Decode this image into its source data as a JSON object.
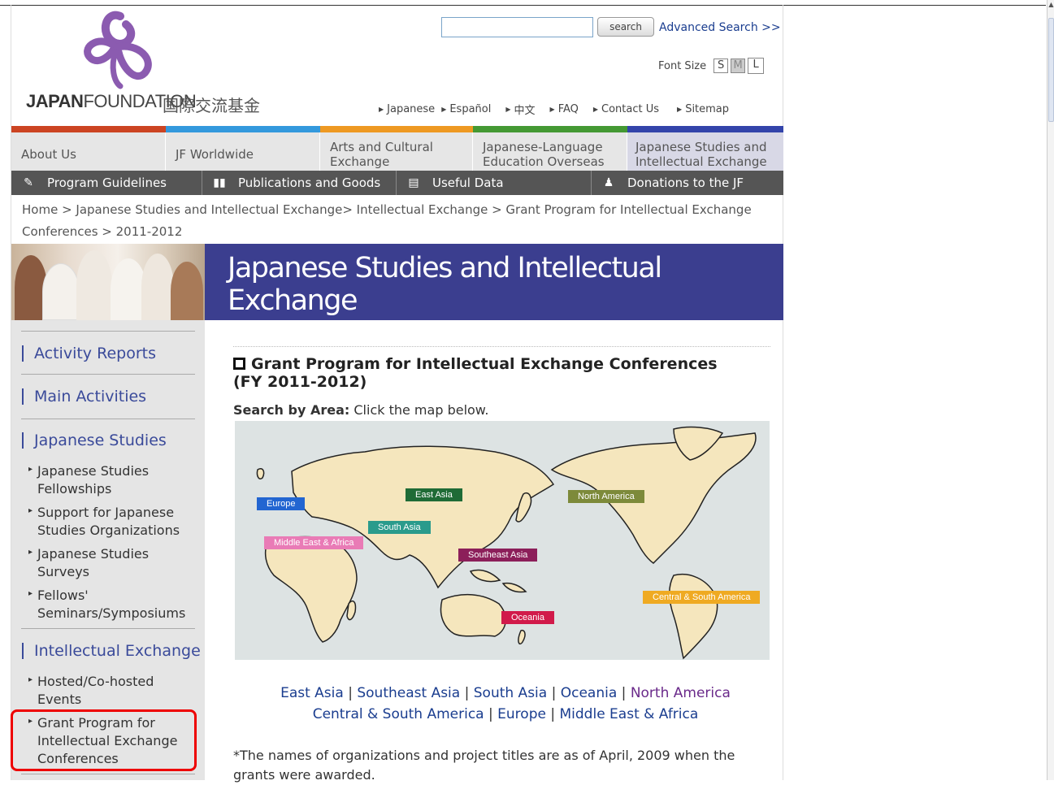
{
  "header": {
    "logo_text_bold": "JAPAN",
    "logo_text_rest": "FOUNDATION",
    "logo_text_jp": "国際交流基金",
    "search": {
      "value": "",
      "placeholder": "",
      "button_label": "search"
    },
    "advanced_search": "Advanced Search >>",
    "font_size": {
      "label": "Font Size",
      "options": [
        "S",
        "M",
        "L"
      ],
      "selected": "M"
    },
    "top_links": [
      "Japanese",
      "Español",
      "中文",
      "FAQ",
      "Contact Us",
      "Sitemap"
    ]
  },
  "colors": {
    "bar1": "#cc4422",
    "bar2": "#3399dd",
    "bar3": "#ee9922",
    "bar4": "#449933",
    "bar5": "#3344aa",
    "banner": "#3b3e8f",
    "link": "#1a3d8f",
    "visited": "#6a2a8a",
    "highlight": "#ee0000"
  },
  "nav_primary": [
    "About Us",
    "JF Worldwide",
    "Arts and Cultural Exchange",
    "Japanese-Language Education Overseas",
    "Japanese Studies and Intellectual Exchange"
  ],
  "nav_secondary": [
    {
      "label": "Program Guidelines",
      "icon": "pen-icon"
    },
    {
      "label": "Publications and Goods",
      "icon": "book-icon"
    },
    {
      "label": "Useful Data",
      "icon": "card-icon"
    },
    {
      "label": "Donations to the JF",
      "icon": "donation-icon"
    }
  ],
  "breadcrumb": "Home > Japanese Studies and Intellectual Exchange> Intellectual Exchange > Grant Program for Intellectual Exchange Conferences > 2011-2012",
  "banner": {
    "title": "Japanese Studies and Intellectual Exchange"
  },
  "sidebar": {
    "activity_reports": "Activity Reports",
    "main_activities": "Main Activities",
    "japanese_studies": "Japanese Studies",
    "japanese_studies_items": [
      "Japanese Studies Fellowships",
      "Support for Japanese Studies Organizations",
      "Japanese Studies Surveys",
      "Fellows' Seminars/Symposiums"
    ],
    "intellectual_exchange": "Intellectual Exchange",
    "intellectual_exchange_items": [
      "Hosted/Co-hosted Events",
      "Grant Program for Intellectual Exchange Conferences"
    ]
  },
  "main": {
    "heading": "Grant Program for Intellectual Exchange Conferences (FY 2011-2012)",
    "search_by_area_bold": "Search by Area:",
    "search_by_area_text": "Click the map below.",
    "map_labels": {
      "europe": "Europe",
      "east_asia": "East Asia",
      "north_america": "North America",
      "south_asia": "South Asia",
      "middle_east": "Middle East & Africa",
      "southeast_asia": "Southeast Asia",
      "central_south_america": "Central & South America",
      "oceania": "Oceania"
    },
    "region_links_row1": [
      "East Asia",
      "Southeast Asia",
      "South Asia",
      "Oceania",
      "North America"
    ],
    "region_links_row2": [
      "Central & South America",
      "Europe",
      "Middle East & Africa"
    ],
    "note": "*The names of organizations and project titles are as of April, 2009 when the grants were awarded."
  }
}
